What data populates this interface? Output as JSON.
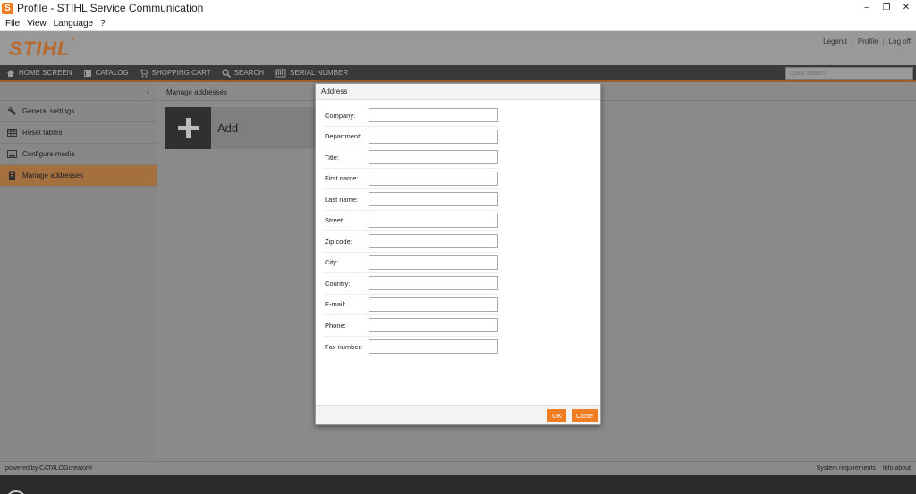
{
  "window": {
    "title": "Profile - STIHL Service Communication",
    "app_icon": "S",
    "minimize": "–",
    "restore": "❐",
    "close": "✕"
  },
  "menu": [
    "File",
    "View",
    "Language",
    "?"
  ],
  "header": {
    "logo": "STIHL",
    "logo_mark": "®",
    "links": [
      "Legend",
      "Profile",
      "Log off"
    ],
    "separator": "|"
  },
  "nav": {
    "items": [
      {
        "label": "HOME SCREEN",
        "icon": "home-icon"
      },
      {
        "label": "CATALOG",
        "icon": "book-icon"
      },
      {
        "label": "SHOPPING CART",
        "icon": "cart-icon"
      },
      {
        "label": "SEARCH",
        "icon": "search-icon"
      },
      {
        "label": "SERIAL NUMBER",
        "icon": "serial-number-icon"
      }
    ],
    "quick_search_placeholder": "Quick search"
  },
  "sidebar": {
    "collapse": "‹",
    "items": [
      {
        "label": "General settings",
        "icon": "wrench-icon"
      },
      {
        "label": "Reset tables",
        "icon": "table-icon"
      },
      {
        "label": "Configure media",
        "icon": "image-icon"
      },
      {
        "label": "Manage addresses",
        "icon": "address-book-icon",
        "active": true
      }
    ]
  },
  "main": {
    "breadcrumb": "Manage addresses",
    "add_label": "Add"
  },
  "dialog": {
    "title": "Address",
    "fields": [
      {
        "label": "Company:",
        "value": ""
      },
      {
        "label": "Department:",
        "value": ""
      },
      {
        "label": "Title:",
        "value": ""
      },
      {
        "label": "First name:",
        "value": ""
      },
      {
        "label": "Last name:",
        "value": ""
      },
      {
        "label": "Street:",
        "value": ""
      },
      {
        "label": "Zip code:",
        "value": ""
      },
      {
        "label": "City:",
        "value": ""
      },
      {
        "label": "Country:",
        "value": ""
      },
      {
        "label": "E-mail:",
        "value": ""
      },
      {
        "label": "Phone:",
        "value": ""
      },
      {
        "label": "Fax number:",
        "value": ""
      }
    ],
    "ok_label": "OK",
    "close_label": "Close"
  },
  "footer": {
    "powered": "powered by CATALOGcreator®",
    "links": [
      "System requirements",
      "Info about"
    ]
  },
  "colors": {
    "accent": "#f07d22",
    "nav_bg": "#3a3a3a"
  }
}
